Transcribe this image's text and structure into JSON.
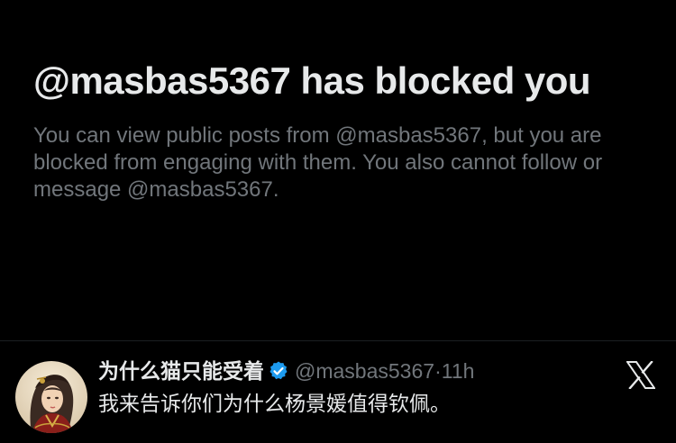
{
  "blocked": {
    "title": "@masbas5367 has blocked you",
    "description": "You can view public posts from @masbas5367, but you are blocked from engaging with them. You also cannot follow or message @masbas5367."
  },
  "tweet": {
    "display_name": "为什么猫只能受着",
    "handle": "@masbas5367",
    "separator": "·",
    "time": "11h",
    "text": "我来告诉你们为什么杨景媛值得钦佩。",
    "verified": true
  },
  "icons": {
    "verified": "verified-badge-icon",
    "brand": "x-logo-icon"
  },
  "colors": {
    "background": "#000000",
    "primary_text": "#e7e9ea",
    "secondary_text": "#71767b",
    "verified_blue": "#1d9bf0"
  }
}
